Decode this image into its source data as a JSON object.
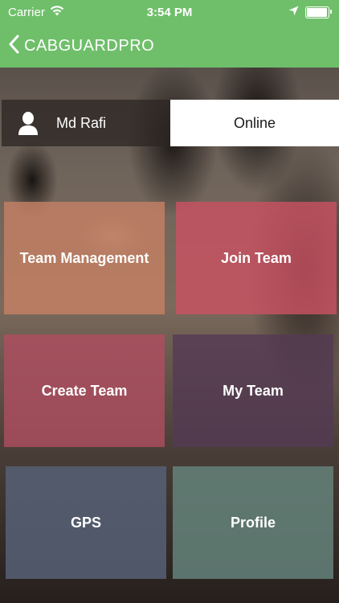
{
  "status_bar": {
    "carrier": "Carrier",
    "time": "3:54 PM",
    "battery_level": 0.95,
    "icons": [
      "wifi-icon",
      "location-arrow-icon",
      "battery-icon"
    ]
  },
  "nav": {
    "back_label": "CABGUARDPRO",
    "icon": "chevron-left-icon"
  },
  "user": {
    "name": "Md Rafi",
    "status": "Online",
    "avatar_icon": "person-icon"
  },
  "tiles": [
    {
      "label": "Team Management",
      "color": "#c48064"
    },
    {
      "label": "Join Team",
      "color": "#c85262"
    },
    {
      "label": "Create Team",
      "color": "#b04e60"
    },
    {
      "label": "My Team",
      "color": "#543a54"
    },
    {
      "label": "GPS",
      "color": "#566076"
    },
    {
      "label": "Profile",
      "color": "#64827a"
    }
  ],
  "colors": {
    "accent": "#6fbf6a",
    "status_box_bg": "#ffffff"
  }
}
